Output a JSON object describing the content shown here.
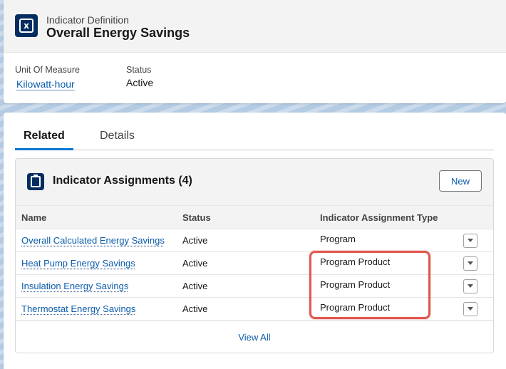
{
  "header": {
    "object_label": "Indicator Definition",
    "record_name": "Overall Energy Savings",
    "fields": [
      {
        "label": "Unit Of Measure",
        "value": "Kilowatt-hour"
      },
      {
        "label": "Status",
        "value": "Active"
      }
    ]
  },
  "tabs": [
    {
      "label": "Related",
      "active": true
    },
    {
      "label": "Details",
      "active": false
    }
  ],
  "related_list": {
    "title": "Indicator Assignments (4)",
    "new_button": "New",
    "columns": [
      "Name",
      "Status",
      "Indicator Assignment Type"
    ],
    "rows": [
      {
        "name": "Overall Calculated Energy Savings",
        "status": "Active",
        "type": "Program"
      },
      {
        "name": "Heat Pump Energy Savings",
        "status": "Active",
        "type": "Program Product"
      },
      {
        "name": "Insulation Energy Savings",
        "status": "Active",
        "type": "Program Product"
      },
      {
        "name": "Thermostat Energy Savings",
        "status": "Active",
        "type": "Program Product"
      }
    ],
    "view_all": "View All"
  },
  "colors": {
    "brand_navy": "#032d60",
    "link": "#0b5cab",
    "tab_active": "#0176d3",
    "highlight": "#e0574f"
  }
}
